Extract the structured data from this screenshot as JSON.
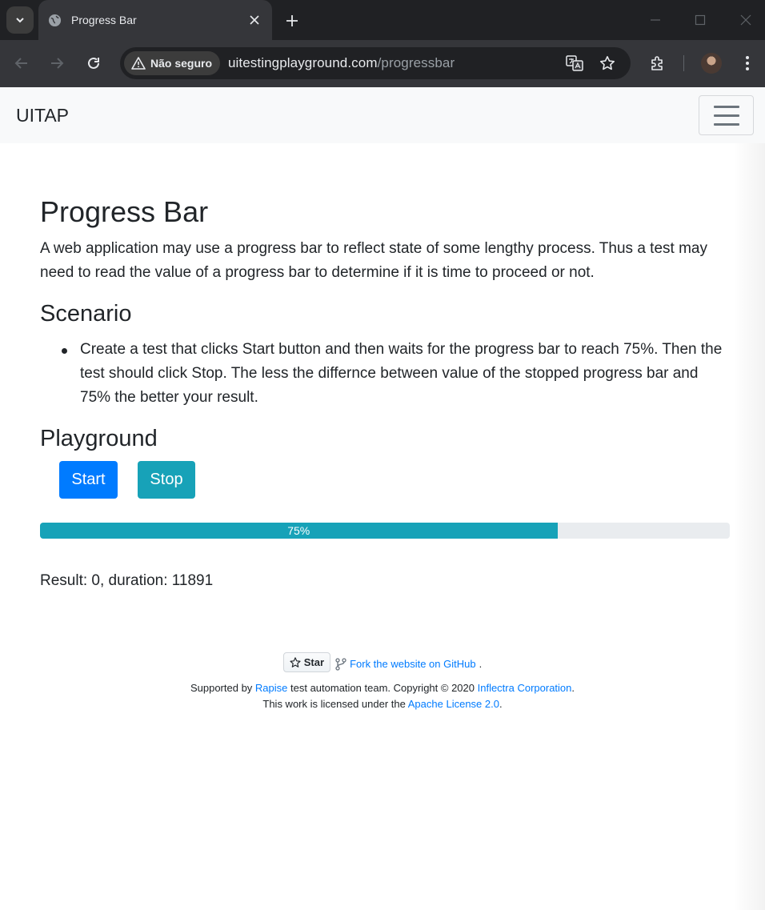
{
  "browser": {
    "tab_title": "Progress Bar",
    "security_label": "Não seguro",
    "url_host": "uitestingplayground.com",
    "url_path": "/progressbar"
  },
  "navbar": {
    "brand": "UITAP"
  },
  "page": {
    "title": "Progress Bar",
    "intro": "A web application may use a progress bar to reflect state of some lengthy process. Thus a test may need to read the value of a progress bar to determine if it is time to proceed or not.",
    "scenario_heading": "Scenario",
    "scenario_items": [
      "Create a test that clicks Start button and then waits for the progress bar to reach 75%. Then the test should click Stop. The less the differnce between value of the stopped progress bar and 75% the better your result."
    ],
    "playground_heading": "Playground",
    "start_label": "Start",
    "stop_label": "Stop",
    "progress_value": 75,
    "progress_label": "75%",
    "result_text": "Result: 0, duration: 11891"
  },
  "footer": {
    "star_label": "Star",
    "fork_link": "Fork the website on GitHub",
    "fork_suffix": ".",
    "supported_prefix": "Supported by ",
    "rapise_link": "Rapise",
    "supported_middle": " test automation team. Copyright © 2020 ",
    "inflectra_link": "Inflectra Corporation",
    "supported_suffix": ".",
    "license_prefix": "This work is licensed under the ",
    "license_link": "Apache License 2.0",
    "license_suffix": "."
  },
  "colors": {
    "primary": "#007bff",
    "info": "#17a2b8",
    "chrome_dark": "#202124"
  }
}
